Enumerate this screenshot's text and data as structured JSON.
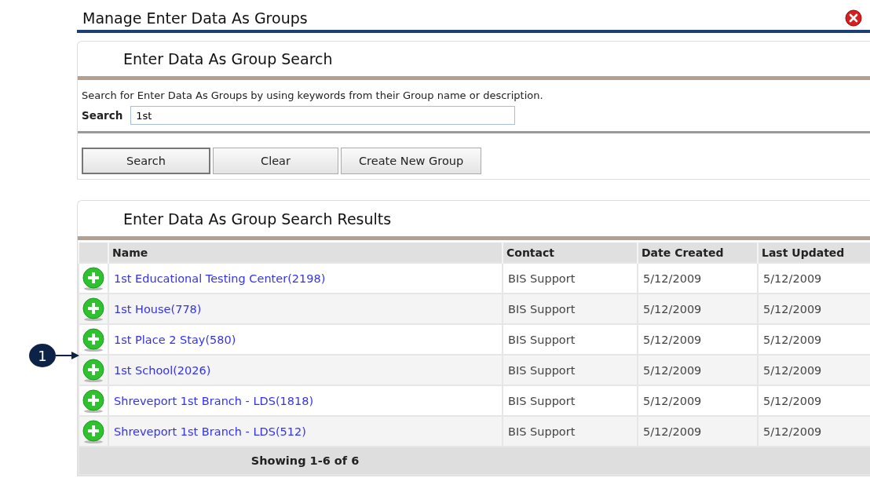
{
  "window": {
    "title": "Manage Enter Data As Groups"
  },
  "search_panel": {
    "title": "Enter Data As Group Search",
    "description": "Search for Enter Data As Groups by using keywords from their Group name or description.",
    "search_label": "Search",
    "search_value": "1st",
    "buttons": [
      "Search",
      "Clear",
      "Create New Group"
    ]
  },
  "results_panel": {
    "title": "Enter Data As Group Search Results",
    "table": {
      "columns": [
        "Name",
        "Contact",
        "Date Created",
        "Last Updated"
      ],
      "rows": [
        {
          "name": "1st Educational Testing Center(2198)",
          "contact": "BIS Support",
          "date_created": "5/12/2009",
          "last_updated": "5/12/2009"
        },
        {
          "name": "1st House(778)",
          "contact": "BIS Support",
          "date_created": "5/12/2009",
          "last_updated": "5/12/2009"
        },
        {
          "name": "1st Place 2 Stay(580)",
          "contact": "BIS Support",
          "date_created": "5/12/2009",
          "last_updated": "5/12/2009"
        },
        {
          "name": "1st School(2026)",
          "contact": "BIS Support",
          "date_created": "5/12/2009",
          "last_updated": "5/12/2009",
          "callout": "1"
        },
        {
          "name": "Shreveport 1st Branch - LDS(1818)",
          "contact": "BIS Support",
          "date_created": "5/12/2009",
          "last_updated": "5/12/2009"
        },
        {
          "name": "Shreveport 1st Branch - LDS(512)",
          "contact": "BIS Support",
          "date_created": "5/12/2009",
          "last_updated": "5/12/2009"
        }
      ]
    },
    "footer": "Showing 1-6 of 6"
  }
}
